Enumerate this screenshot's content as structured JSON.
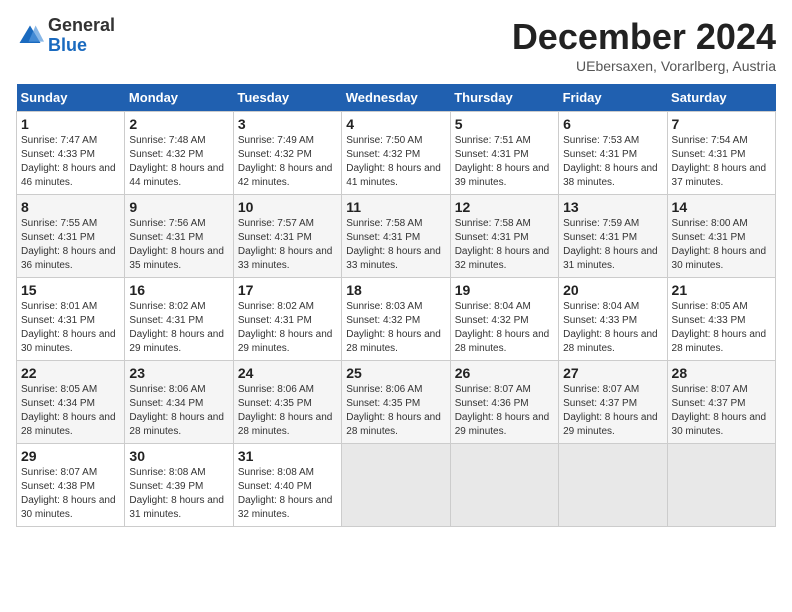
{
  "header": {
    "logo_general": "General",
    "logo_blue": "Blue",
    "month_title": "December 2024",
    "subtitle": "UEbersaxen, Vorarlberg, Austria"
  },
  "calendar": {
    "days_of_week": [
      "Sunday",
      "Monday",
      "Tuesday",
      "Wednesday",
      "Thursday",
      "Friday",
      "Saturday"
    ],
    "weeks": [
      [
        {
          "day": "1",
          "sunrise": "Sunrise: 7:47 AM",
          "sunset": "Sunset: 4:33 PM",
          "daylight": "Daylight: 8 hours and 46 minutes."
        },
        {
          "day": "2",
          "sunrise": "Sunrise: 7:48 AM",
          "sunset": "Sunset: 4:32 PM",
          "daylight": "Daylight: 8 hours and 44 minutes."
        },
        {
          "day": "3",
          "sunrise": "Sunrise: 7:49 AM",
          "sunset": "Sunset: 4:32 PM",
          "daylight": "Daylight: 8 hours and 42 minutes."
        },
        {
          "day": "4",
          "sunrise": "Sunrise: 7:50 AM",
          "sunset": "Sunset: 4:32 PM",
          "daylight": "Daylight: 8 hours and 41 minutes."
        },
        {
          "day": "5",
          "sunrise": "Sunrise: 7:51 AM",
          "sunset": "Sunset: 4:31 PM",
          "daylight": "Daylight: 8 hours and 39 minutes."
        },
        {
          "day": "6",
          "sunrise": "Sunrise: 7:53 AM",
          "sunset": "Sunset: 4:31 PM",
          "daylight": "Daylight: 8 hours and 38 minutes."
        },
        {
          "day": "7",
          "sunrise": "Sunrise: 7:54 AM",
          "sunset": "Sunset: 4:31 PM",
          "daylight": "Daylight: 8 hours and 37 minutes."
        }
      ],
      [
        {
          "day": "8",
          "sunrise": "Sunrise: 7:55 AM",
          "sunset": "Sunset: 4:31 PM",
          "daylight": "Daylight: 8 hours and 36 minutes."
        },
        {
          "day": "9",
          "sunrise": "Sunrise: 7:56 AM",
          "sunset": "Sunset: 4:31 PM",
          "daylight": "Daylight: 8 hours and 35 minutes."
        },
        {
          "day": "10",
          "sunrise": "Sunrise: 7:57 AM",
          "sunset": "Sunset: 4:31 PM",
          "daylight": "Daylight: 8 hours and 33 minutes."
        },
        {
          "day": "11",
          "sunrise": "Sunrise: 7:58 AM",
          "sunset": "Sunset: 4:31 PM",
          "daylight": "Daylight: 8 hours and 33 minutes."
        },
        {
          "day": "12",
          "sunrise": "Sunrise: 7:58 AM",
          "sunset": "Sunset: 4:31 PM",
          "daylight": "Daylight: 8 hours and 32 minutes."
        },
        {
          "day": "13",
          "sunrise": "Sunrise: 7:59 AM",
          "sunset": "Sunset: 4:31 PM",
          "daylight": "Daylight: 8 hours and 31 minutes."
        },
        {
          "day": "14",
          "sunrise": "Sunrise: 8:00 AM",
          "sunset": "Sunset: 4:31 PM",
          "daylight": "Daylight: 8 hours and 30 minutes."
        }
      ],
      [
        {
          "day": "15",
          "sunrise": "Sunrise: 8:01 AM",
          "sunset": "Sunset: 4:31 PM",
          "daylight": "Daylight: 8 hours and 30 minutes."
        },
        {
          "day": "16",
          "sunrise": "Sunrise: 8:02 AM",
          "sunset": "Sunset: 4:31 PM",
          "daylight": "Daylight: 8 hours and 29 minutes."
        },
        {
          "day": "17",
          "sunrise": "Sunrise: 8:02 AM",
          "sunset": "Sunset: 4:31 PM",
          "daylight": "Daylight: 8 hours and 29 minutes."
        },
        {
          "day": "18",
          "sunrise": "Sunrise: 8:03 AM",
          "sunset": "Sunset: 4:32 PM",
          "daylight": "Daylight: 8 hours and 28 minutes."
        },
        {
          "day": "19",
          "sunrise": "Sunrise: 8:04 AM",
          "sunset": "Sunset: 4:32 PM",
          "daylight": "Daylight: 8 hours and 28 minutes."
        },
        {
          "day": "20",
          "sunrise": "Sunrise: 8:04 AM",
          "sunset": "Sunset: 4:33 PM",
          "daylight": "Daylight: 8 hours and 28 minutes."
        },
        {
          "day": "21",
          "sunrise": "Sunrise: 8:05 AM",
          "sunset": "Sunset: 4:33 PM",
          "daylight": "Daylight: 8 hours and 28 minutes."
        }
      ],
      [
        {
          "day": "22",
          "sunrise": "Sunrise: 8:05 AM",
          "sunset": "Sunset: 4:34 PM",
          "daylight": "Daylight: 8 hours and 28 minutes."
        },
        {
          "day": "23",
          "sunrise": "Sunrise: 8:06 AM",
          "sunset": "Sunset: 4:34 PM",
          "daylight": "Daylight: 8 hours and 28 minutes."
        },
        {
          "day": "24",
          "sunrise": "Sunrise: 8:06 AM",
          "sunset": "Sunset: 4:35 PM",
          "daylight": "Daylight: 8 hours and 28 minutes."
        },
        {
          "day": "25",
          "sunrise": "Sunrise: 8:06 AM",
          "sunset": "Sunset: 4:35 PM",
          "daylight": "Daylight: 8 hours and 28 minutes."
        },
        {
          "day": "26",
          "sunrise": "Sunrise: 8:07 AM",
          "sunset": "Sunset: 4:36 PM",
          "daylight": "Daylight: 8 hours and 29 minutes."
        },
        {
          "day": "27",
          "sunrise": "Sunrise: 8:07 AM",
          "sunset": "Sunset: 4:37 PM",
          "daylight": "Daylight: 8 hours and 29 minutes."
        },
        {
          "day": "28",
          "sunrise": "Sunrise: 8:07 AM",
          "sunset": "Sunset: 4:37 PM",
          "daylight": "Daylight: 8 hours and 30 minutes."
        }
      ],
      [
        {
          "day": "29",
          "sunrise": "Sunrise: 8:07 AM",
          "sunset": "Sunset: 4:38 PM",
          "daylight": "Daylight: 8 hours and 30 minutes."
        },
        {
          "day": "30",
          "sunrise": "Sunrise: 8:08 AM",
          "sunset": "Sunset: 4:39 PM",
          "daylight": "Daylight: 8 hours and 31 minutes."
        },
        {
          "day": "31",
          "sunrise": "Sunrise: 8:08 AM",
          "sunset": "Sunset: 4:40 PM",
          "daylight": "Daylight: 8 hours and 32 minutes."
        },
        null,
        null,
        null,
        null
      ]
    ]
  }
}
